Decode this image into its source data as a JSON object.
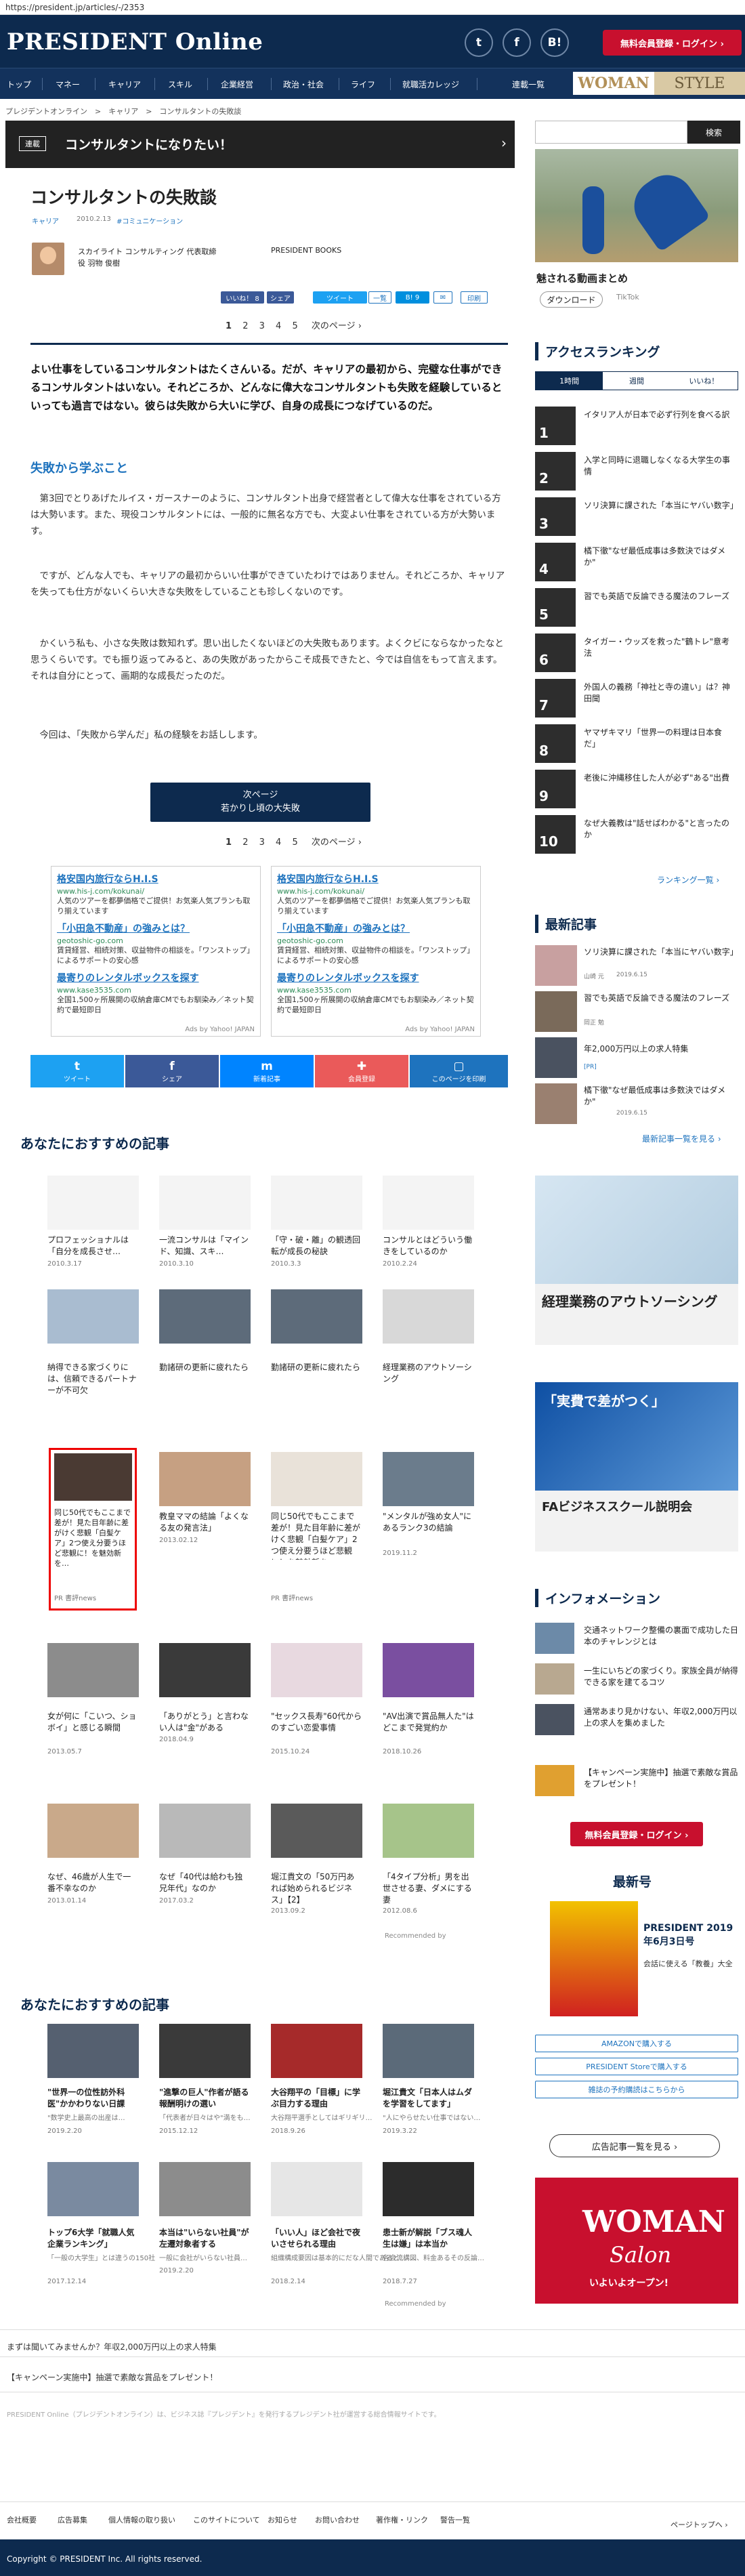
{
  "browser": {
    "url": "https://president.jp/articles/-/2353"
  },
  "header": {
    "logo": "PRESIDENT Online",
    "twitter_icon": "twitter-icon",
    "facebook_icon": "facebook-icon",
    "hatena_icon": "hatena-icon",
    "member_button": "無料会員登録・ログイン ›"
  },
  "nav": {
    "items": [
      "トップ",
      "マネー",
      "キャリア",
      "スキル",
      "企業経営",
      "政治・社会",
      "ライフ",
      "就職活カレッジ",
      "連載一覧"
    ],
    "woman": "WOMAN",
    "style": "STYLE"
  },
  "breadcrumb": "プレジデントオンライン　>　キャリア　>　コンサルタントの失敗談",
  "series": {
    "tag": "連載",
    "title": "コンサルタントになりたい！",
    "arrow": "›"
  },
  "search": {
    "placeholder": "",
    "button": "検索"
  },
  "top_ad": {
    "caption": "魅される動画まとめ",
    "button": "ダウンロード",
    "brand": "TikTok"
  },
  "article": {
    "title": "コンサルタントの失敗談",
    "category": "キャリア",
    "date": "2010.2.13",
    "tag": "#コミュニケーション",
    "author_line1": "スカイライト コンサルティング 代表取締",
    "author_line2": "役 羽物 俊樹",
    "publisher": "PRESIDENT BOOKS",
    "share": [
      "いいね！ 8",
      "シェア",
      "ツイート",
      "一覧",
      "B! 9",
      "✉",
      "印刷"
    ],
    "pager": [
      "1",
      "2",
      "3",
      "4",
      "5",
      "次のページ ›"
    ],
    "lead": "よい仕事をしているコンサルタントはたくさんいる。だが、キャリアの最初から、完璧な仕事ができるコンサルタントはいない。それどころか、どんなに偉大なコンサルタントも失敗を経験しているといっても過言ではない。彼らは失敗から大いに学び、自身の成長につなげているのだ。",
    "subhead": "失敗から学ぶこと",
    "p1": "　第3回でとりあげたルイス・ガースナーのように、コンサルタント出身で経営者として偉大な仕事をされている方は大勢います。また、現役コンサルタントには、一般的に無名な方でも、大変よい仕事をされている方が大勢います。",
    "p2": "　ですが、どんな人でも、キャリアの最初からいい仕事ができていたわけではありません。それどころか、キャリアを失っても仕方がないくらい大きな失敗をしていることも珍しくないのです。",
    "p3": "　かくいう私も、小さな失敗は数知れず。思い出したくないほどの大失敗もあります。よくクビにならなかったなと思うくらいです。でも振り返ってみると、あの失敗があったからこそ成長できたと、今では自信をもって言えます。それは自分にとって、画期的な成長だったのだ。",
    "p4": "　今回は、「失敗から学んだ」私の経験をお話しします。",
    "next_button_l1": "次ページ",
    "next_button_l2": "若かりし頃の大失敗"
  },
  "text_ads": [
    {
      "l1": "格安国内旅行ならH.I.S",
      "u1": "www.his-j.com/kokunai/",
      "d1": "人気のツアーを都夢価格でご提供！お気楽人気プランも取り揃えています",
      "l2": "「小田急不動産」の強みとは？",
      "u2": "geotoshic-go.com",
      "d2": "賃貸経営、相続対策、収益物件の相談を。「ワンストップ」によるサポートの安心感",
      "l3": "最寄りのレンタルボックスを探す",
      "u3": "www.kase3535.com",
      "d3": "全国1,500ヶ所展開の収納倉庫CMでもお馴染み／ネット契約で最短即日",
      "jp": "Ads by Yahoo! JAPAN"
    },
    {
      "l1": "格安国内旅行ならH.I.S",
      "u1": "www.his-j.com/kokunai/",
      "d1": "人気のツアーを都夢価格でご提供！お気楽人気プランも取り揃えています",
      "l2": "「小田急不動産」の強みとは？",
      "u2": "geotoshic-go.com",
      "d2": "賃貸経営、相続対策、収益物件の相談を。「ワンストップ」によるサポートの安心感",
      "l3": "最寄りのレンタルボックスを探す",
      "u3": "www.kase3535.com",
      "d3": "全国1,500ヶ所展開の収納倉庫CMでもお馴染み／ネット契約で最短即日",
      "jp": "Ads by Yahoo! JAPAN"
    }
  ],
  "share_bar": [
    {
      "icon": "t",
      "label": "ツイート",
      "color": "#1da1f2"
    },
    {
      "icon": "f",
      "label": "シェア",
      "color": "#3b5998"
    },
    {
      "icon": "m",
      "label": "新着記事",
      "color": "#0084ff"
    },
    {
      "icon": "✚",
      "label": "会員登録",
      "color": "#ea5a5a"
    },
    {
      "icon": "▢",
      "label": "このページを印刷",
      "color": "#1e73be"
    }
  ],
  "rec1": {
    "title": "あなたにおすすめの記事",
    "row1": [
      {
        "t": "プロフェッショナルは「自分を成長させ…",
        "d": "2010.3.17"
      },
      {
        "t": "一流コンサルは「マインド、知識、スキ…",
        "d": "2010.3.10"
      },
      {
        "t": "「守・破・離」の観透回転が成長の秘訣",
        "d": "2010.3.3"
      },
      {
        "t": "コンサルとはどういう働きをしているのか",
        "d": "2010.2.24"
      }
    ],
    "row2": [
      {
        "t": "納得できる家づくりには、信頼できるパートナーが不可欠"
      },
      {
        "t": "勤諸研の更新に疲れたら"
      },
      {
        "t": "勤諸研の更新に疲れたら"
      },
      {
        "t": "経理業務のアウトソーシング"
      }
    ],
    "row3": [
      {
        "t": "同じ50代でもここまで差が！見た目年齢に差がけく悲観「白髪ケア」2つ使え分要うほど悲観に！を魅効新を…",
        "d": "PR 書評news"
      },
      {
        "t": "教皇ママの結論「よくなる友の発言法」",
        "d": "2013.02.12"
      },
      {
        "t": "同じ50代でもここまで差が！見た目年齢に差がけく悲観「白髪ケア」2つ使え分要うほど悲観に！を魅効新を…",
        "d": "PR 書評news"
      },
      {
        "t": "\"メンタルが強め女人\"にあるランク3の結論",
        "d": "2019.11.2"
      }
    ],
    "row4": [
      {
        "t": "女が何に「こいつ、ショボイ」と感じる瞬間",
        "d": "2013.05.7"
      },
      {
        "t": "「ありがとう」と言わない人は\"金\"がある",
        "d": "2018.04.9"
      },
      {
        "t": "\"セックス長寿\"60代からのすごい恋愛事情",
        "d": "2015.10.24"
      },
      {
        "t": "\"AV出演で賞品無人た\"はどこまで発覚約か",
        "d": "2018.10.26"
      }
    ],
    "row5": [
      {
        "t": "なぜ、46歳が人生で一番不幸なのか",
        "d": "2013.01.14"
      },
      {
        "t": "なぜ「40代は給わも独兄年代」なのか",
        "d": "2017.03.2"
      },
      {
        "t": "堀江貴文の「50万円あれば始められるビジネス」【2】",
        "d": "2013.09.2"
      },
      {
        "t": "「4タイプ分析」男を出世させる妻、ダメにする妻",
        "d": "2012.08.6"
      }
    ],
    "powered": "Recommended by"
  },
  "rec2": {
    "title": "あなたにおすすめの記事",
    "row1": [
      {
        "t": "\"世界一の位性訪外科医\"かかわりない日課",
        "s": "\"数学史上最高の出産は…",
        "d": "2019.2.20"
      },
      {
        "t": "\"進撃の巨人\"作者が語る報酬明けの選い",
        "s": "「代表者が日々はや\"満をも…",
        "d": "2015.12.12"
      },
      {
        "t": "大谷翔平の「目標」に学ぶ目力する理由",
        "s": "大谷翔平選手としてはギリギリ…",
        "d": "2018.9.26"
      },
      {
        "t": "堀江貴文「日本人はムダを学習をしてます」",
        "s": "\"人にやらせたい仕事ではない…",
        "d": "2019.3.22"
      }
    ],
    "row2": [
      {
        "t": "トップ6大学「就職人気企業ランキング」",
        "s": "「一般の大学生」とは違うの150社",
        "d": "2017.12.14"
      },
      {
        "t": "本当は\"いらない社員\"が左遷対象者する",
        "s": "一般に会社がいらない社員…",
        "d": "2019.2.20"
      },
      {
        "t": "「いい人」ほど会社で夜いさせられる理由",
        "s": "組織構成要因は基本的にだな人間であると…",
        "d": "2018.2.14"
      },
      {
        "t": "患士新が解説「ブス魂人生は嫌」は本当か",
        "s": "各会流構図、料金あるその反論…",
        "d": "2018.7.27"
      }
    ],
    "powered": "Recommended by"
  },
  "sidebar": {
    "ranking_title": "アクセスランキング",
    "tabs": [
      "1時間",
      "週間",
      "いいね！"
    ],
    "ranking": [
      "イタリア人が日本で必ず行列を食べる訳",
      "入学と同時に退職しなくなる大学生の事情",
      "ソリ決算に課された「本当にヤバい数字」",
      "橘下徹\"なぜ最低成事は多数決ではダメか\"",
      "習でも英語で反論できる魔法のフレーズ",
      "タイガー・ウッズを救った\"鶴トレ\"意考法",
      "外国人の義務「神社と寺の違い」は？神田聞",
      "ヤマザキマリ「世界一の料理は日本食だ」",
      "老後に沖縄移住した人が必ず\"ある\"出費",
      "なぜ大義教は\"話せばわかる\"と言ったのか"
    ],
    "ranking_more": "ランキング一覧 ›",
    "news_title": "最新記事",
    "news": [
      {
        "t": "ソリ決算に課された「本当にヤバい数字」",
        "a": "山崎 元",
        "d": "2019.6.15"
      },
      {
        "t": "習でも英語で反論できる魔法のフレーズ",
        "a": "岡正 勉",
        "d": ""
      },
      {
        "t": "年2,000万円以上の求人特集",
        "a": "",
        "d": "[PR]"
      },
      {
        "t": "橘下徹\"なぜ最低成事は多数決ではダメか\"",
        "a": "",
        "d": "2019.6.15"
      }
    ],
    "news_more": "最新記事一覧を見る ›",
    "ad1_title": "経理業務のアウトソーシング",
    "ad2_title": "FAビジネススクール説明会",
    "ad2_sub": "「実費で差がつく」",
    "info_title": "インフォメーション",
    "info": [
      "交通ネットワーク整備の裏面で成功した日本のチャレンジとは",
      "一生にいちどの家づくり。家族全員が納得できる家を建てるコツ",
      "通常あまり見かけない、年収2,000万円以上の求人を集めました",
      "【キャンペーン実施中】抽選で素敵な賞品をプレゼント！"
    ],
    "member_button": "無料会員登録・ログイン ›",
    "latest_title": "最新号",
    "mag_title": "PRESIDENT 2019年6月3日号",
    "mag_sub": "会話に使える「教養」大全",
    "buttons": [
      "AMAZONで購入する",
      "PRESIDENT Storeで購入する",
      "雑誌の予約購読はこちらから"
    ],
    "adlist_button": "広告記事一覧を見る ›",
    "woman_salon": "WOMAN",
    "woman_salon2": "Salon",
    "woman_salon3": "いよいよオープン!"
  },
  "footer": {
    "link1": "まずは聞いてみませんか？年収2,000万円以上の求人特集",
    "link2": "【キャンペーン実施中】抽選で素敵な賞品をプレゼント！",
    "disclaimer": "PRESIDENT Online（プレジデントオンライン）は、ビジネス誌『プレジデント』を発行するプレジデント社が運営する総合情報サイトです。",
    "nav": [
      "会社概要",
      "広告募集",
      "個人情報の取り扱い",
      "このサイトについて",
      "お知らせ",
      "お問い合わせ",
      "著作権・リンク",
      "警告一覧"
    ],
    "pagetop": "ページトップへ ›",
    "copyright": "Copyright © PRESIDENT Inc. All rights reserved."
  }
}
